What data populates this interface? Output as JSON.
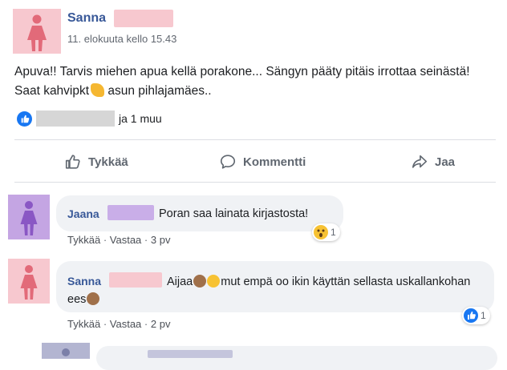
{
  "post": {
    "author": "Sanna",
    "time": "11. elokuuta kello 15.43",
    "text_part1": "Apuva!! Tarvis miehen apua kellä porakone... Sängyn pääty pitäis irrottaa seinästä! Saat kahvipkt",
    "text_part2": " asun pihlajamäes..",
    "reactions_rest": "ja 1 muu",
    "colors": {
      "avatar_bg": "#f7c8cf",
      "avatar_icon": "#e26a79",
      "redact": "#f7c8cf"
    }
  },
  "actions": [
    {
      "label": "Tykkää",
      "icon": "thumb-up-icon"
    },
    {
      "label": "Kommentti",
      "icon": "comment-icon"
    },
    {
      "label": "Jaa",
      "icon": "share-icon"
    }
  ],
  "comments": [
    {
      "author": "Jaana",
      "text": "Poran saa lainata kirjastosta!",
      "like": "Tykkää",
      "sep": "·",
      "reply": "Vastaa",
      "age": "3 pv",
      "reaction_count": "1",
      "reaction_icon": "wow-icon",
      "colors": {
        "avatar_bg": "#c4a5e3",
        "avatar_icon": "#8a57c4",
        "redact": "#c9aee8"
      }
    },
    {
      "author": "Sanna",
      "text_part1": "Aijaa",
      "text_part2": "mut empä oo ikin käyttän sellasta uskallankohan ees",
      "like": "Tykkää",
      "sep": "·",
      "reply": "Vastaa",
      "age": "2 pv",
      "reaction_count": "1",
      "reaction_icon": "like-icon",
      "colors": {
        "avatar_bg": "#f7c8cf",
        "avatar_icon": "#e26a79",
        "redact": "#f7c8cf"
      }
    }
  ]
}
